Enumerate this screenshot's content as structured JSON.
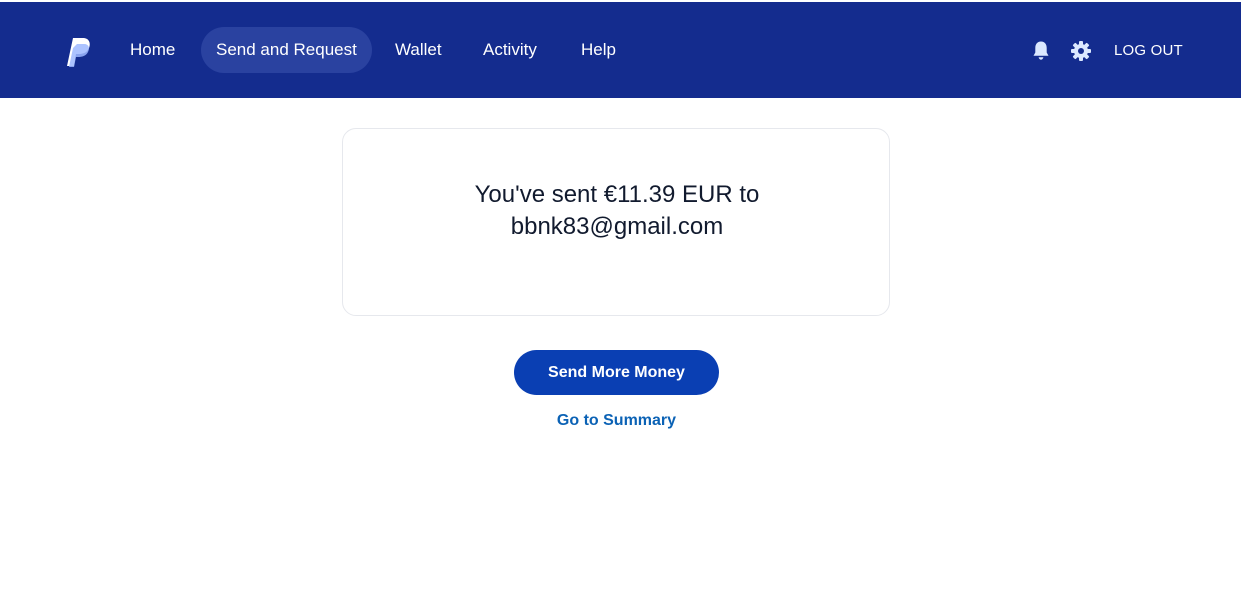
{
  "header": {
    "logo_icon": "paypal-logo-icon",
    "nav": {
      "home": "Home",
      "send_and_request": "Send and Request",
      "wallet": "Wallet",
      "activity": "Activity",
      "help": "Help"
    },
    "active_nav": "send_and_request",
    "notifications_icon": "bell-icon",
    "settings_icon": "gear-icon",
    "logout_label": "LOG OUT"
  },
  "confirmation": {
    "line1": "You've sent €11.39 EUR to",
    "line2": "bbnk83@gmail.com"
  },
  "actions": {
    "send_more_label": "Send More Money",
    "summary_link_label": "Go to Summary"
  },
  "colors": {
    "header_bg": "#142c8e",
    "active_nav_bg": "#2a42a0",
    "primary_button": "#0a3fb3",
    "link": "#0b62b5",
    "icon_fill": "#dbe8ff"
  }
}
